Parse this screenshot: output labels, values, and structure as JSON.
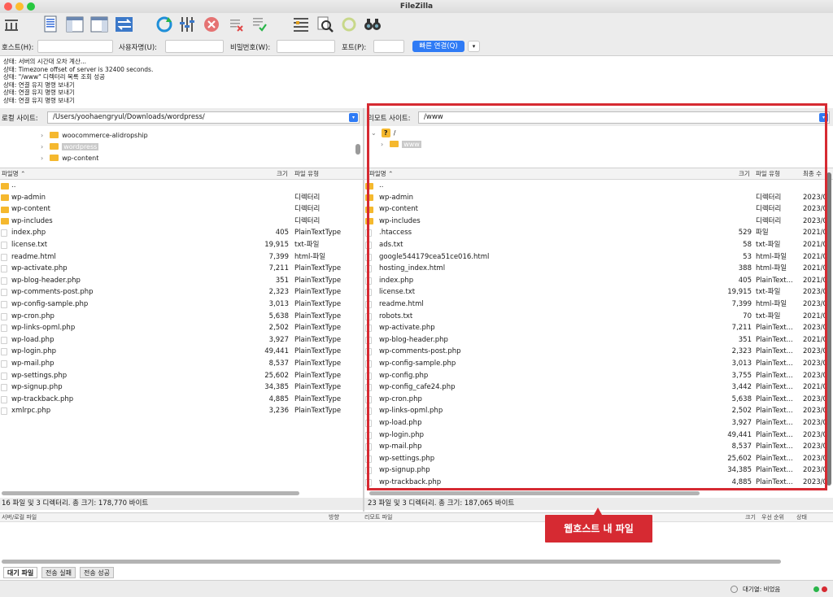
{
  "window": {
    "title": "FileZilla"
  },
  "toolbar": {
    "icons": [
      "site-manager-icon",
      "toggle-log-icon",
      "toggle-local-tree-icon",
      "toggle-remote-tree-icon",
      "transfer-queue-icon",
      "refresh-icon",
      "process-queue-icon",
      "cancel-icon",
      "disconnect-icon",
      "reconnect-icon",
      "directory-filter-icon",
      "compare-icon",
      "sync-browse-icon",
      "search-icon"
    ]
  },
  "quickconnect": {
    "host_label": "호스트(H):",
    "user_label": "사용자명(U):",
    "pass_label": "비밀번호(W):",
    "port_label": "포트(P):",
    "connect_label": "빠른 연결(Q)",
    "dropdown_glyph": "▾"
  },
  "log": [
    "상태:  서버의 시간대 오차 계산...",
    "상태:  Timezone offset of server is 32400 seconds.",
    "상태:  \"/www\" 디렉터리 목록 조회 성공",
    "상태:  연결 유지 명령 보내기",
    "상태:  연결 유지 명령 보내기",
    "상태:  연결 유지 명령 보내기"
  ],
  "local": {
    "site_label": "로컬 사이트:",
    "path": "/Users/yoohaengryul/Downloads/wordpress/",
    "tree": [
      {
        "name": "woocommerce-alidropship",
        "selected": false
      },
      {
        "name": "wordpress",
        "selected": true
      },
      {
        "name": "wp-content",
        "selected": false
      }
    ],
    "columns": {
      "name": "파일명",
      "size": "크기",
      "type": "파일 유형"
    },
    "files": [
      {
        "name": "..",
        "size": "",
        "type": "",
        "folder": true
      },
      {
        "name": "wp-admin",
        "size": "",
        "type": "디렉터리",
        "folder": true
      },
      {
        "name": "wp-content",
        "size": "",
        "type": "디렉터리",
        "folder": true
      },
      {
        "name": "wp-includes",
        "size": "",
        "type": "디렉터리",
        "folder": true
      },
      {
        "name": "index.php",
        "size": "405",
        "type": "PlainTextType",
        "folder": false
      },
      {
        "name": "license.txt",
        "size": "19,915",
        "type": "txt-파일",
        "folder": false
      },
      {
        "name": "readme.html",
        "size": "7,399",
        "type": "html-파일",
        "folder": false
      },
      {
        "name": "wp-activate.php",
        "size": "7,211",
        "type": "PlainTextType",
        "folder": false
      },
      {
        "name": "wp-blog-header.php",
        "size": "351",
        "type": "PlainTextType",
        "folder": false
      },
      {
        "name": "wp-comments-post.php",
        "size": "2,323",
        "type": "PlainTextType",
        "folder": false
      },
      {
        "name": "wp-config-sample.php",
        "size": "3,013",
        "type": "PlainTextType",
        "folder": false
      },
      {
        "name": "wp-cron.php",
        "size": "5,638",
        "type": "PlainTextType",
        "folder": false
      },
      {
        "name": "wp-links-opml.php",
        "size": "2,502",
        "type": "PlainTextType",
        "folder": false
      },
      {
        "name": "wp-load.php",
        "size": "3,927",
        "type": "PlainTextType",
        "folder": false
      },
      {
        "name": "wp-login.php",
        "size": "49,441",
        "type": "PlainTextType",
        "folder": false
      },
      {
        "name": "wp-mail.php",
        "size": "8,537",
        "type": "PlainTextType",
        "folder": false
      },
      {
        "name": "wp-settings.php",
        "size": "25,602",
        "type": "PlainTextType",
        "folder": false
      },
      {
        "name": "wp-signup.php",
        "size": "34,385",
        "type": "PlainTextType",
        "folder": false
      },
      {
        "name": "wp-trackback.php",
        "size": "4,885",
        "type": "PlainTextType",
        "folder": false
      },
      {
        "name": "xmlrpc.php",
        "size": "3,236",
        "type": "PlainTextType",
        "folder": false
      }
    ],
    "status": "16 파일 및 3 디렉터리. 총 크기: 178,770 바이트"
  },
  "remote": {
    "site_label": "리모트 사이트:",
    "path": "/www",
    "tree": [
      {
        "name": "/",
        "selected": false
      },
      {
        "name": "www",
        "selected": true
      }
    ],
    "columns": {
      "name": "파일명",
      "size": "크기",
      "type": "파일 유형",
      "modified": "최종 수"
    },
    "files": [
      {
        "name": "..",
        "size": "",
        "type": "",
        "modified": "",
        "folder": true
      },
      {
        "name": "wp-admin",
        "size": "",
        "type": "디렉터리",
        "modified": "2023/0",
        "folder": true
      },
      {
        "name": "wp-content",
        "size": "",
        "type": "디렉터리",
        "modified": "2023/0",
        "folder": true
      },
      {
        "name": "wp-includes",
        "size": "",
        "type": "디렉터리",
        "modified": "2023/0",
        "folder": true
      },
      {
        "name": ".htaccess",
        "size": "529",
        "type": "파일",
        "modified": "2021/0",
        "folder": false
      },
      {
        "name": "ads.txt",
        "size": "58",
        "type": "txt-파일",
        "modified": "2021/0",
        "folder": false
      },
      {
        "name": "google544179cea51ce016.html",
        "size": "53",
        "type": "html-파일",
        "modified": "2021/0",
        "folder": false
      },
      {
        "name": "hosting_index.html",
        "size": "388",
        "type": "html-파일",
        "modified": "2021/0",
        "folder": false
      },
      {
        "name": "index.php",
        "size": "405",
        "type": "PlainText...",
        "modified": "2021/0",
        "folder": false
      },
      {
        "name": "license.txt",
        "size": "19,915",
        "type": "txt-파일",
        "modified": "2023/0",
        "folder": false
      },
      {
        "name": "readme.html",
        "size": "7,399",
        "type": "html-파일",
        "modified": "2023/0",
        "folder": false
      },
      {
        "name": "robots.txt",
        "size": "70",
        "type": "txt-파일",
        "modified": "2021/0",
        "folder": false
      },
      {
        "name": "wp-activate.php",
        "size": "7,211",
        "type": "PlainText...",
        "modified": "2023/0",
        "folder": false
      },
      {
        "name": "wp-blog-header.php",
        "size": "351",
        "type": "PlainText...",
        "modified": "2021/0",
        "folder": false
      },
      {
        "name": "wp-comments-post.php",
        "size": "2,323",
        "type": "PlainText...",
        "modified": "2023/0",
        "folder": false
      },
      {
        "name": "wp-config-sample.php",
        "size": "3,013",
        "type": "PlainText...",
        "modified": "2023/0",
        "folder": false
      },
      {
        "name": "wp-config.php",
        "size": "3,755",
        "type": "PlainText...",
        "modified": "2023/0",
        "folder": false
      },
      {
        "name": "wp-config_cafe24.php",
        "size": "3,442",
        "type": "PlainText...",
        "modified": "2021/0",
        "folder": false
      },
      {
        "name": "wp-cron.php",
        "size": "5,638",
        "type": "PlainText...",
        "modified": "2023/0",
        "folder": false
      },
      {
        "name": "wp-links-opml.php",
        "size": "2,502",
        "type": "PlainText...",
        "modified": "2023/0",
        "folder": false
      },
      {
        "name": "wp-load.php",
        "size": "3,927",
        "type": "PlainText...",
        "modified": "2023/0",
        "folder": false
      },
      {
        "name": "wp-login.php",
        "size": "49,441",
        "type": "PlainText...",
        "modified": "2023/0",
        "folder": false
      },
      {
        "name": "wp-mail.php",
        "size": "8,537",
        "type": "PlainText...",
        "modified": "2023/0",
        "folder": false
      },
      {
        "name": "wp-settings.php",
        "size": "25,602",
        "type": "PlainText...",
        "modified": "2023/0",
        "folder": false
      },
      {
        "name": "wp-signup.php",
        "size": "34,385",
        "type": "PlainText...",
        "modified": "2023/0",
        "folder": false
      },
      {
        "name": "wp-trackback.php",
        "size": "4,885",
        "type": "PlainText...",
        "modified": "2023/0",
        "folder": false
      }
    ],
    "status": "23 파일 및 3 디렉터리. 총 크기: 187,065 바이트"
  },
  "queue": {
    "columns": {
      "server": "서버/로컬 파일",
      "direction": "방향",
      "remote": "리모트 파일",
      "size": "크기",
      "priority": "우선 순위",
      "status": "상태"
    },
    "tabs": [
      "대기 파일",
      "전송 실패",
      "전송 성공"
    ],
    "footer": "대기열: 비었음"
  },
  "annotation": {
    "label": "웹호스트 내 파일"
  },
  "colors": {
    "accent": "#2f7bf5",
    "highlight": "#d62a32",
    "folder": "#f5b82e"
  }
}
